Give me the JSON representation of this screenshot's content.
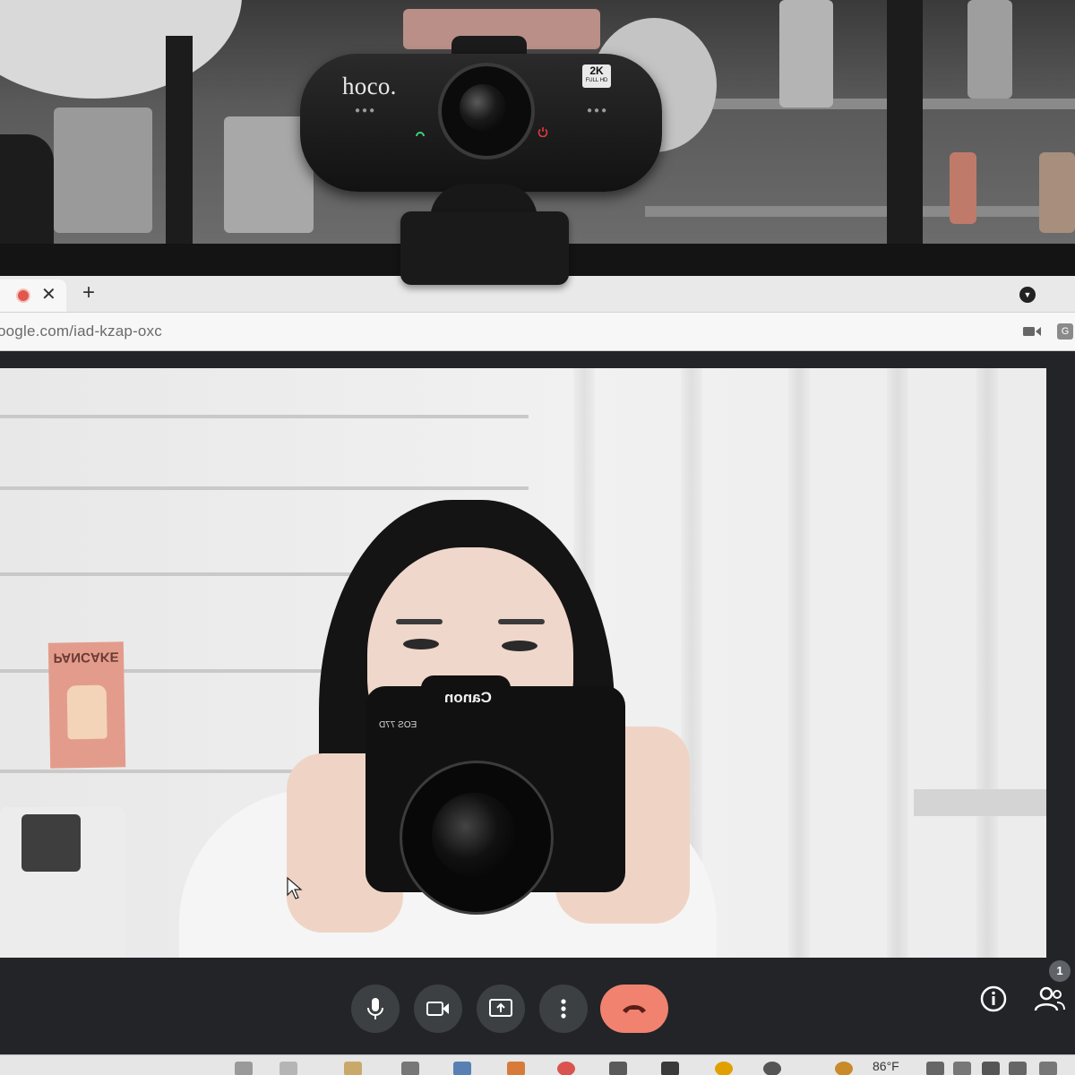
{
  "webcam": {
    "brand": "hoco.",
    "badge_top": "2K",
    "badge_bottom": "FULL HD"
  },
  "browser": {
    "tab_close_glyph": "✕",
    "new_tab_glyph": "+",
    "url": "oogle.com/iad-kzap-oxc"
  },
  "video": {
    "poster_text": "PANCAKE",
    "camera_brand": "Canon",
    "camera_model": "EOS 77D"
  },
  "call_controls": {
    "participant_count": "1"
  },
  "taskbar": {
    "temperature": "86°F"
  },
  "colors": {
    "hangup": "#f0826f",
    "control_bg": "#3c4043",
    "recording": "#e2574c"
  },
  "icons": [
    "recording-icon",
    "close-icon",
    "plus-icon",
    "tab-menu-icon",
    "video-camera-icon",
    "translate-icon",
    "microphone-icon",
    "camera-icon",
    "present-screen-icon",
    "more-options-icon",
    "hang-up-icon",
    "info-icon",
    "people-icon",
    "cursor-icon"
  ]
}
